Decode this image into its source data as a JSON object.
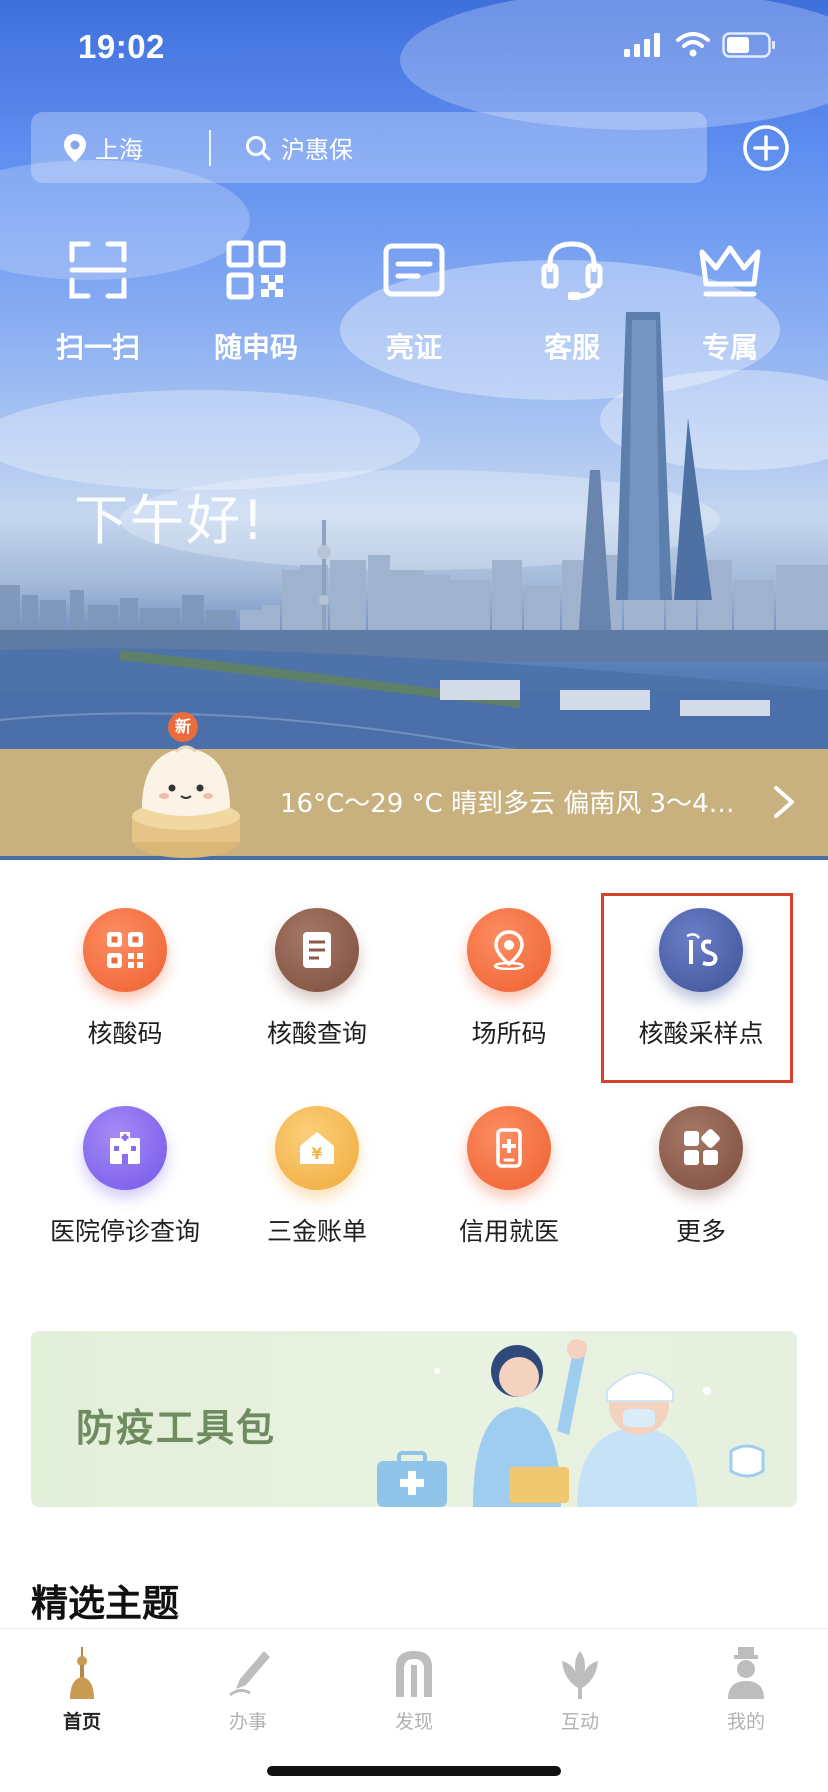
{
  "status_bar": {
    "time": "19:02"
  },
  "header": {
    "location": "上海",
    "search_placeholder": "沪惠保",
    "add_icon": "plus-circle-icon"
  },
  "quick_actions": [
    {
      "label": "扫一扫",
      "icon": "scan-icon"
    },
    {
      "label": "随申码",
      "icon": "qr-code-icon"
    },
    {
      "label": "亮证",
      "icon": "id-card-icon"
    },
    {
      "label": "客服",
      "icon": "headset-icon"
    },
    {
      "label": "专属",
      "icon": "crown-icon"
    }
  ],
  "greeting": "下午好!",
  "weather": {
    "badge": "新",
    "text": "16°C～29 °C 晴到多云 偏南风 3～4…"
  },
  "services": [
    {
      "label": "核酸码",
      "icon": "qr-code-icon",
      "color": "#f06a3b"
    },
    {
      "label": "核酸查询",
      "icon": "document-icon",
      "color": "#8a5a48"
    },
    {
      "label": "场所码",
      "icon": "location-pin-icon",
      "color": "#f06a3b"
    },
    {
      "label": "核酸采样点",
      "icon": "sampling-point-icon",
      "color": "#4a5ea8"
    },
    {
      "label": "医院停诊查询",
      "icon": "hospital-icon",
      "color": "#8a6cf0"
    },
    {
      "label": "三金账单",
      "icon": "house-yuan-icon",
      "color": "#f2b84a"
    },
    {
      "label": "信用就医",
      "icon": "medical-phone-icon",
      "color": "#f06a3b"
    },
    {
      "label": "更多",
      "icon": "grid-more-icon",
      "color": "#8a5a48"
    }
  ],
  "banner": {
    "title": "防疫工具包"
  },
  "section": {
    "title": "精选主题"
  },
  "tabbar": {
    "items": [
      {
        "label": "首页",
        "icon": "home-tower-icon",
        "active": true
      },
      {
        "label": "办事",
        "icon": "pen-icon",
        "active": false
      },
      {
        "label": "发现",
        "icon": "arch-icon",
        "active": false
      },
      {
        "label": "互动",
        "icon": "magnolia-icon",
        "active": false
      },
      {
        "label": "我的",
        "icon": "person-icon",
        "active": false
      }
    ]
  },
  "colors": {
    "accent_gold": "#c8b17e",
    "highlight_red": "#d9412f",
    "banner_green": "#6e8c5f"
  }
}
